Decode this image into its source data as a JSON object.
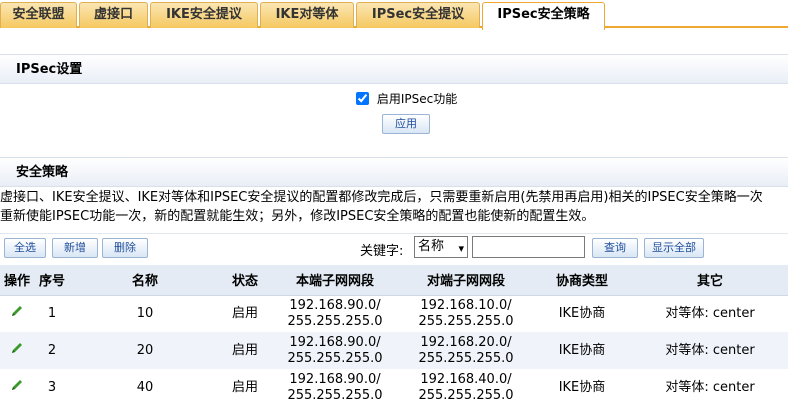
{
  "tabs": [
    {
      "label": "安全联盟",
      "active": false
    },
    {
      "label": "虚接口",
      "active": false
    },
    {
      "label": "IKE安全提议",
      "active": false
    },
    {
      "label": "IKE对等体",
      "active": false
    },
    {
      "label": "IPSec安全提议",
      "active": false
    },
    {
      "label": "IPSec安全策略",
      "active": true
    }
  ],
  "ipsec_settings": {
    "title": "IPSec设置",
    "enable_label": "启用IPSec功能",
    "enable_checked": true,
    "apply_label": "应用"
  },
  "security_policy": {
    "title": "安全策略",
    "description_line1": "虚接口、IKE安全提议、IKE对等体和IPSEC安全提议的配置都修改完成后，只需要重新启用(先禁用再启用)相关的IPSEC安全策略一次",
    "description_line2": "重新使能IPSEC功能一次，新的配置就能生效；另外，修改IPSEC安全策略的配置也能使新的配置生效。"
  },
  "toolbar": {
    "select_all": "全选",
    "add": "新增",
    "delete": "删除",
    "keyword_label": "关键字:",
    "keyword_field": "名称",
    "keyword_value": "",
    "search": "查询",
    "show_all": "显示全部"
  },
  "table": {
    "headers": [
      "操作",
      "序号",
      "名称",
      "状态",
      "本端子网网段",
      "对端子网网段",
      "协商类型",
      "其它"
    ],
    "rows": [
      {
        "index": "1",
        "name": "10",
        "status": "启用",
        "local_net": "192.168.90.0/",
        "local_mask": "255.255.255.0",
        "remote_net": "192.168.10.0/",
        "remote_mask": "255.255.255.0",
        "nego": "IKE协商",
        "other": "对等体: center"
      },
      {
        "index": "2",
        "name": "20",
        "status": "启用",
        "local_net": "192.168.90.0/",
        "local_mask": "255.255.255.0",
        "remote_net": "192.168.20.0/",
        "remote_mask": "255.255.255.0",
        "nego": "IKE协商",
        "other": "对等体: center"
      },
      {
        "index": "3",
        "name": "40",
        "status": "启用",
        "local_net": "192.168.90.0/",
        "local_mask": "255.255.255.0",
        "remote_net": "192.168.40.0/",
        "remote_mask": "255.255.255.0",
        "nego": "IKE协商",
        "other": "对等体: center"
      }
    ]
  },
  "colors": {
    "tab_accent": "#f0a830",
    "button_text": "#1f4e9c",
    "edit_icon": "#3a9a2a"
  },
  "icons": {
    "edit": "pencil-icon"
  }
}
